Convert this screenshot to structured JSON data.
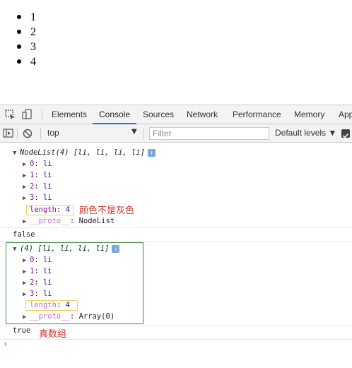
{
  "page_list": {
    "items": [
      "1",
      "2",
      "3",
      "4"
    ]
  },
  "devtools": {
    "tabs": [
      "Elements",
      "Console",
      "Sources",
      "Network",
      "Performance",
      "Memory",
      "App"
    ],
    "active_tab": "Console",
    "toolbar": {
      "context": "top",
      "filter_placeholder": "Filter",
      "levels": "Default levels ▼"
    },
    "console": {
      "nodelist_header": "NodeList(4) [li, li, li, li]",
      "nodelist_items": [
        {
          "key": "0",
          "value": "li"
        },
        {
          "key": "1",
          "value": "li"
        },
        {
          "key": "2",
          "value": "li"
        },
        {
          "key": "3",
          "value": "li"
        }
      ],
      "nodelist_length_key": "length",
      "nodelist_length_value": "4",
      "nodelist_proto_key": "__proto__",
      "nodelist_proto_value": "NodeList",
      "result1": "false",
      "array_header": "(4) [li, li, li, li]",
      "array_items": [
        {
          "key": "0",
          "value": "li"
        },
        {
          "key": "1",
          "value": "li"
        },
        {
          "key": "2",
          "value": "li"
        },
        {
          "key": "3",
          "value": "li"
        }
      ],
      "array_length_key": "length",
      "array_length_value": "4",
      "array_proto_key": "__proto__",
      "array_proto_value": "Array(0)",
      "result2": "true",
      "prompt": "›"
    },
    "annotations": {
      "not_gray": "颜色不是灰色",
      "real_array": "真数组"
    }
  }
}
